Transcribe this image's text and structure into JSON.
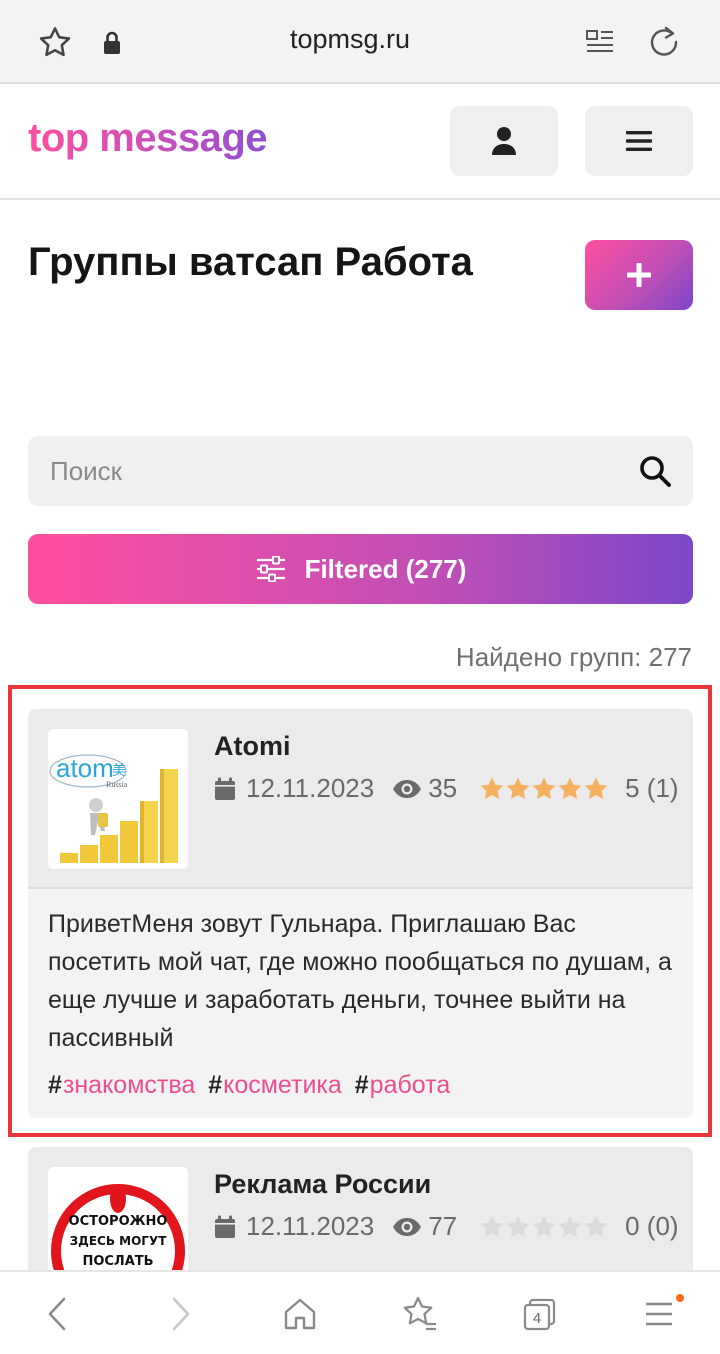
{
  "browser": {
    "url": "topmsg.ru",
    "icons": [
      "star-icon",
      "lock-icon",
      "reader-icon",
      "reload-icon"
    ]
  },
  "header": {
    "logo": "top message",
    "icons": [
      "user-icon",
      "hamburger-icon"
    ]
  },
  "page": {
    "title": "Группы ватсап Работа",
    "add_icon": "plus-icon"
  },
  "search": {
    "placeholder": "Поиск",
    "value": ""
  },
  "filter": {
    "label": "Filtered (277)"
  },
  "results": {
    "found_text": "Найдено групп: 277"
  },
  "colors": {
    "accent_pink": "#ff4f9e",
    "accent_purple": "#7d47c8",
    "star_filled": "#f5b060",
    "star_empty": "#dcdcdc",
    "highlight": "#e8363c"
  },
  "groups": [
    {
      "name": "Atomi",
      "date": "12.11.2023",
      "views": "35",
      "rating": 5,
      "rating_text": "5 (1)",
      "description": "ПриветМеня зовут Гульнара. Приглашаю Вас посетить мой чат, где можно пообщаться по душам, а еще лучше и заработать деньги, точнее выйти на пассивный",
      "tags": [
        {
          "hash": "#",
          "label": "знакомства"
        },
        {
          "hash": "#",
          "label": "косметика"
        },
        {
          "hash": "#",
          "label": "работа"
        }
      ],
      "thumb_logo": "atom",
      "thumb_logo_sub": "Russia",
      "thumb_logo_mark": "美"
    },
    {
      "name": "Реклама России",
      "date": "12.11.2023",
      "views": "77",
      "rating": 0,
      "rating_text": "0 (0)",
      "thumb_lines": [
        "ОСТОРОЖНО",
        "ЗДЕСЬ МОГУТ",
        "ПОСЛАТЬ"
      ]
    }
  ],
  "bottom_nav": {
    "items": [
      "back-icon",
      "forward-icon",
      "home-icon",
      "bookmarks-icon",
      "tabs-icon",
      "menu-icon"
    ],
    "tabs_count": "4"
  }
}
